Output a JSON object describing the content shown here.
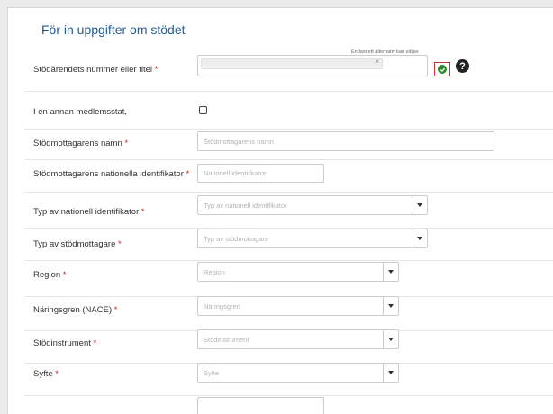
{
  "section": {
    "title": "För in uppgifter om stödet"
  },
  "required_mark": "*",
  "fields": {
    "case_number": {
      "label": "Stödärendets nummer eller titel",
      "hint": "Endast ett alternativ kan väljas",
      "chip_remove": "×"
    },
    "other_member_state": {
      "label": "I en annan medlemsstat,"
    },
    "recipient_name": {
      "label": "Stödmottagarens namn",
      "placeholder": "Stödmottagarens namn"
    },
    "national_id": {
      "label": "Stödmottagarens nationella identifikator",
      "placeholder": "Nationell identifikator"
    },
    "id_type": {
      "label": "Typ av nationell identifikator",
      "placeholder": "Typ av nationell identifikator"
    },
    "recipient_type": {
      "label": "Typ av stödmottagare",
      "placeholder": "Typ av stödmottagare"
    },
    "region": {
      "label": "Region",
      "placeholder": "Region"
    },
    "nace": {
      "label": "Näringsgren (NACE)",
      "placeholder": "Näringsgren"
    },
    "instrument": {
      "label": "Stödinstrument",
      "placeholder": "Stödinstrument"
    },
    "purpose": {
      "label": "Syfte",
      "placeholder": "Syfte"
    }
  },
  "icons": {
    "help": "?",
    "help_icon": "question-circle-icon",
    "ok_icon": "check-circle-icon"
  },
  "colors": {
    "title": "#1f5c99",
    "required": "#cc2222",
    "ok_border": "#c43838",
    "ok_fill": "#2f8a2f"
  }
}
